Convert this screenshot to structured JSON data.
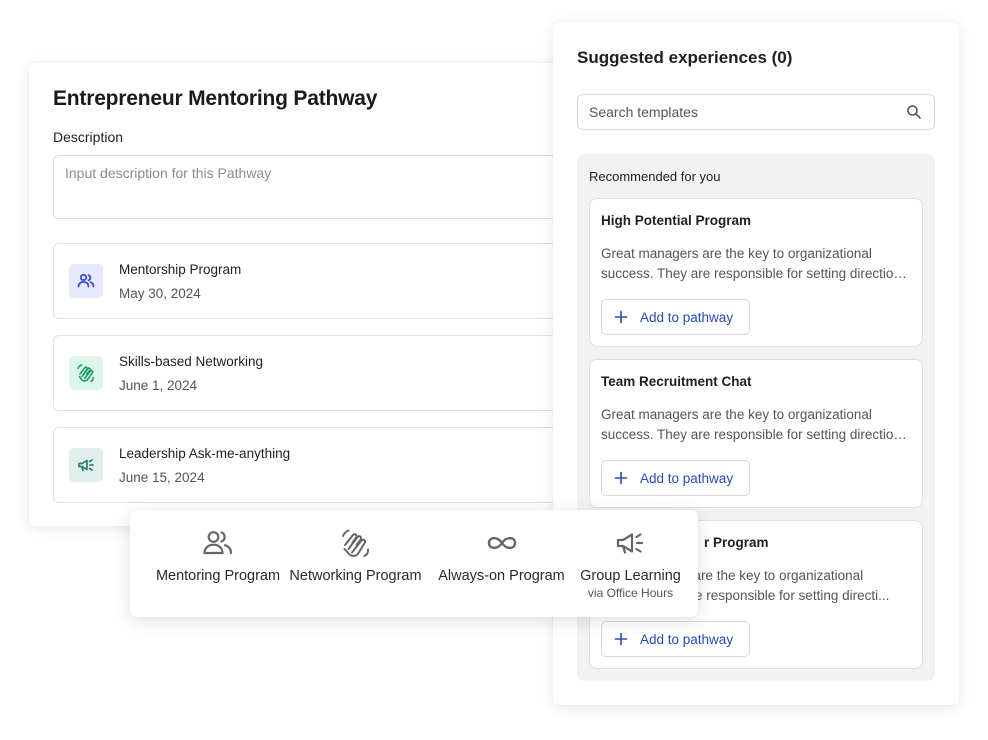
{
  "pathway": {
    "title": "Entrepreneur Mentoring Pathway",
    "description_label": "Description",
    "description_placeholder": "Input description for this Pathway",
    "description_value": "",
    "experiences": [
      {
        "title": "Mentorship Program",
        "date": "May 30, 2024",
        "icon": "people-icon",
        "icon_bg": "#e6e8fb",
        "icon_color": "#3f4fd1"
      },
      {
        "title": "Skills-based Networking",
        "date": "June 1, 2024",
        "icon": "handshake-icon",
        "icon_bg": "#dcf6ea",
        "icon_color": "#1f9d6c"
      },
      {
        "title": "Leadership Ask-me-anything",
        "date": "June 15, 2024",
        "icon": "megaphone-icon",
        "icon_bg": "#e0efec",
        "icon_color": "#2f7f72"
      }
    ]
  },
  "suggestions": {
    "title": "Suggested experiences (0)",
    "search_placeholder": "Search templates",
    "search_value": "",
    "recommended_label": "Recommended for you",
    "add_label": "Add to pathway",
    "cards": [
      {
        "title": "High Potential Program",
        "description": "Great managers are the key to organizational success. They are responsible for setting direction and supporting their teams."
      },
      {
        "title": "Team Recruitment Chat",
        "description": "Great managers are the key to organizational success. They are responsible for setting direction and supporting their teams."
      },
      {
        "title": "r Program",
        "description": "s are the key to organizational\nare responsible for setting directi..."
      }
    ]
  },
  "program_types": [
    {
      "label": "Mentoring Program",
      "sublabel": "",
      "icon": "people-icon"
    },
    {
      "label": "Networking Program",
      "sublabel": "",
      "icon": "handshake-icon"
    },
    {
      "label": "Always-on Program",
      "sublabel": "",
      "icon": "infinity-icon"
    },
    {
      "label": "Group Learning",
      "sublabel": "via Office Hours",
      "icon": "megaphone-icon"
    }
  ],
  "colors": {
    "accent": "#2b48b8",
    "icon_gray": "#666666"
  }
}
